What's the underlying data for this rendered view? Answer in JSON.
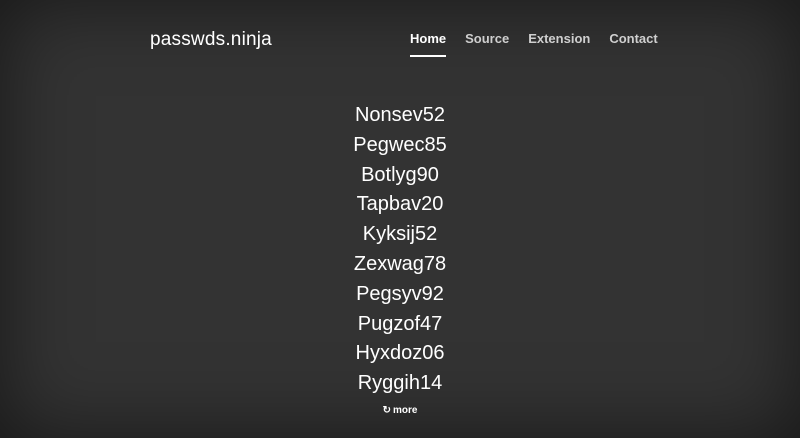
{
  "brand": "passwds.ninja",
  "nav": {
    "items": [
      {
        "label": "Home",
        "active": true
      },
      {
        "label": "Source",
        "active": false
      },
      {
        "label": "Extension",
        "active": false
      },
      {
        "label": "Contact",
        "active": false
      }
    ]
  },
  "passwords": [
    "Nonsev52",
    "Pegwec85",
    "Botlyg90",
    "Tapbav20",
    "Kyksij52",
    "Zexwag78",
    "Pegsyv92",
    "Pugzof47",
    "Hyxdoz06",
    "Ryggih14"
  ],
  "more": {
    "icon": "refresh-icon",
    "label": "more"
  }
}
